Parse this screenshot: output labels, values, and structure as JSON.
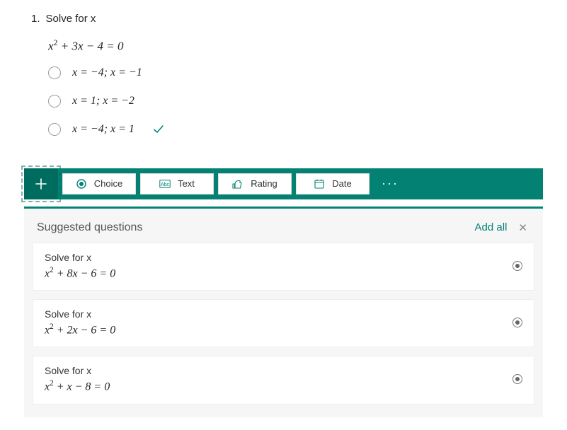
{
  "question": {
    "number": "1.",
    "title": "Solve for x",
    "equation_html": "x<sup>2</sup> + 3x − 4 = 0",
    "answers": [
      {
        "text": "x = −4; x = −1",
        "correct": false
      },
      {
        "text": "x = 1; x = −2",
        "correct": false
      },
      {
        "text": "x = −4; x = 1",
        "correct": true
      }
    ]
  },
  "toolbar": {
    "plus_label": "Add question",
    "choice_label": "Choice",
    "text_label": "Text",
    "rating_label": "Rating",
    "date_label": "Date",
    "more_label": "More"
  },
  "suggested": {
    "header": "Suggested questions",
    "add_all": "Add all",
    "items": [
      {
        "title": "Solve for x",
        "equation_html": "x<sup>2</sup> + 8x − 6 = 0"
      },
      {
        "title": "Solve for x",
        "equation_html": "x<sup>2</sup> + 2x − 6 = 0"
      },
      {
        "title": "Solve for x",
        "equation_html": "x<sup>2</sup> + x − 8 = 0"
      }
    ]
  }
}
